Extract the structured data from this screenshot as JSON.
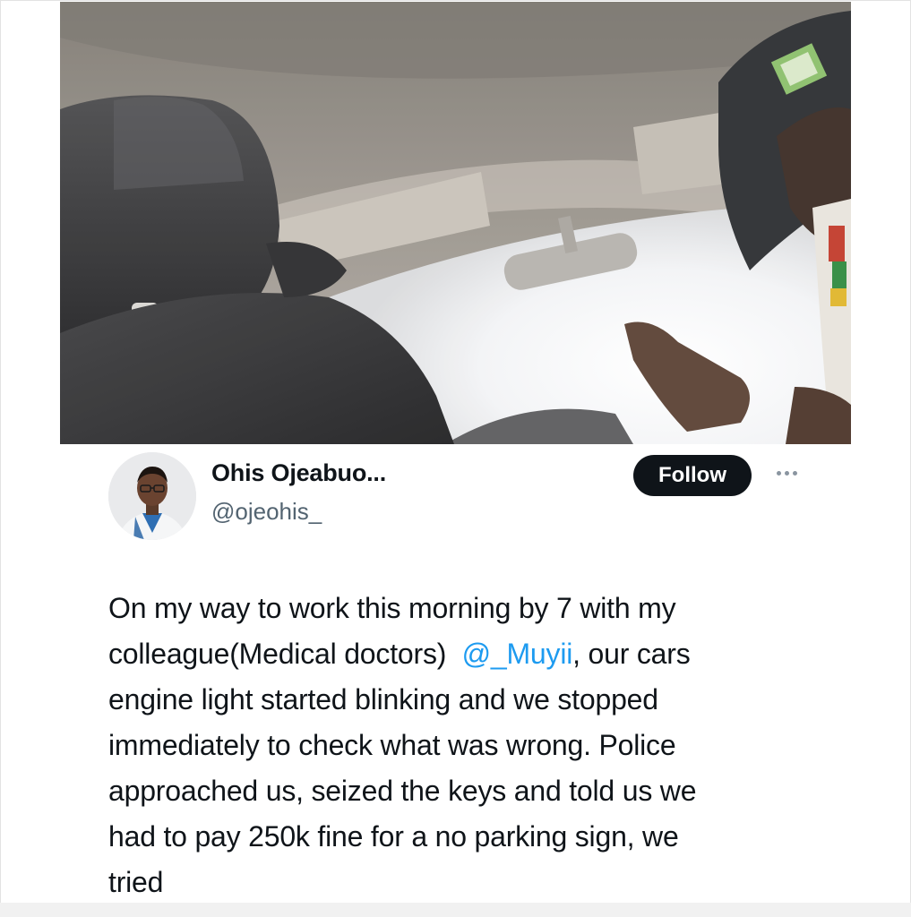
{
  "author": {
    "display_name": "Ohis Ojeabuo...",
    "handle": "@ojeohis_"
  },
  "actions": {
    "follow_label": "Follow",
    "more_icon": "more-horizontal-icon"
  },
  "tweet": {
    "lines": [
      {
        "before": "On my way to work this morning by 7 with my",
        "mention": "",
        "after": ""
      },
      {
        "before": "colleague(Medical doctors)  ",
        "mention": "@_Muyii",
        "after": ", our cars"
      },
      {
        "before": "engine light started blinking and we stopped",
        "mention": "",
        "after": ""
      },
      {
        "before": "immediately to check what was wrong. Police",
        "mention": "",
        "after": ""
      },
      {
        "before": "approached us, seized the keys and told us we",
        "mention": "",
        "after": ""
      },
      {
        "before": "had to pay 250k fine for a no parking sign, we",
        "mention": "",
        "after": ""
      },
      {
        "before": "tried",
        "mention": "",
        "after": ""
      }
    ]
  },
  "colors": {
    "text_primary": "#0f1419",
    "text_secondary": "#536471",
    "mention": "#1d9bf0",
    "follow_bg": "#0f1419",
    "follow_text": "#ffffff"
  }
}
